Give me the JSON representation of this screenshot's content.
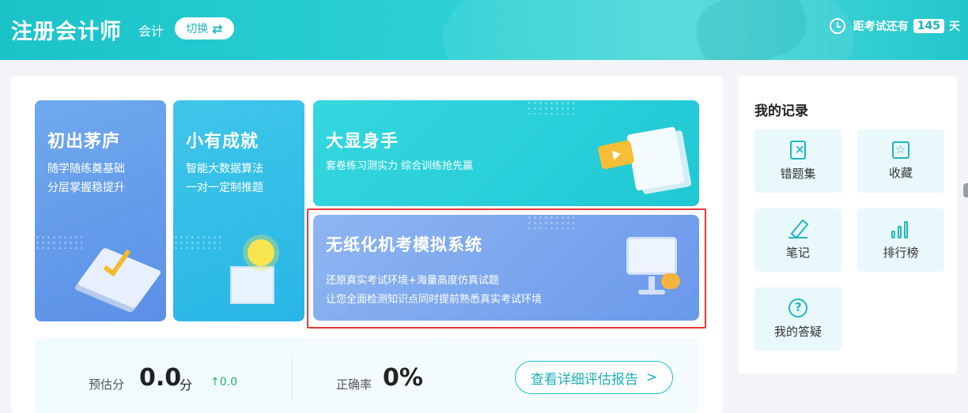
{
  "header": {
    "app_title": "注册会计师",
    "subject": "会计",
    "switch_label": "切换",
    "countdown_prefix": "距考试还有",
    "countdown_days": "145",
    "countdown_suffix": "天"
  },
  "cards": [
    {
      "title": "初出茅庐",
      "desc": "随学随练奠基础\n分层掌握稳提升"
    },
    {
      "title": "小有成就",
      "desc": "智能大数据算法\n一对一定制推题"
    },
    {
      "title": "大显身手",
      "desc": "套卷练习测实力  综合训练抢先赢"
    },
    {
      "title": "无纸化机考模拟系统",
      "desc": "还原真实考试环境+海量高度仿真试题\n让您全面检测知识点同时提前熟悉真实考试环境"
    }
  ],
  "score": {
    "est_label": "预估分",
    "est_value": "0.0",
    "est_unit": "分",
    "est_change": "0.0",
    "acc_label": "正确率",
    "acc_value": "0%",
    "report_button": "查看详细评估报告"
  },
  "records": {
    "title": "我的记录",
    "items": [
      {
        "label": "错题集",
        "icon": "wrong-book-icon"
      },
      {
        "label": "收藏",
        "icon": "favorite-icon"
      },
      {
        "label": "笔记",
        "icon": "note-pencil-icon"
      },
      {
        "label": "排行榜",
        "icon": "ranking-bars-icon"
      },
      {
        "label": "我的答疑",
        "icon": "question-icon"
      }
    ]
  },
  "colors": {
    "brand": "#1bc3c9",
    "highlight": "#e23a3a",
    "up": "#27b06a"
  }
}
